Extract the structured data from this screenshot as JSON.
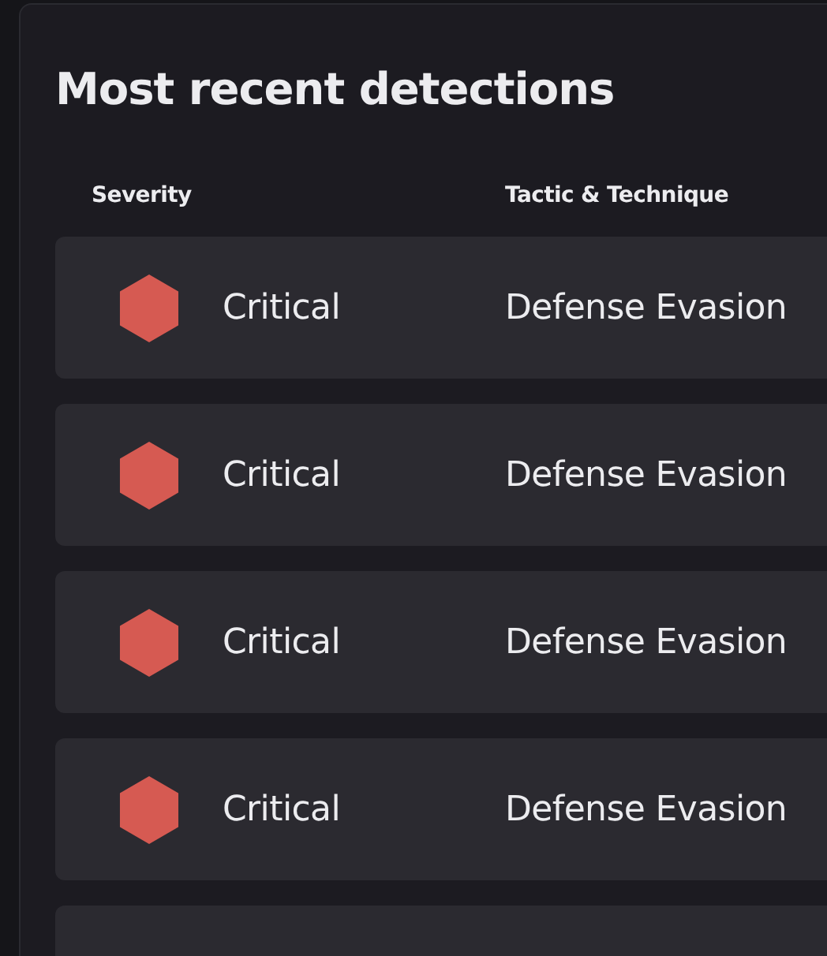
{
  "panel": {
    "title": "Most recent detections"
  },
  "table": {
    "columns": [
      "Severity",
      "Tactic & Technique"
    ],
    "rows": [
      {
        "severity": "Critical",
        "color": "#d65a52",
        "tactic": "Defense Evasion"
      },
      {
        "severity": "Critical",
        "color": "#d65a52",
        "tactic": "Defense Evasion"
      },
      {
        "severity": "Critical",
        "color": "#d65a52",
        "tactic": "Defense Evasion"
      },
      {
        "severity": "Critical",
        "color": "#d65a52",
        "tactic": "Defense Evasion"
      }
    ]
  }
}
